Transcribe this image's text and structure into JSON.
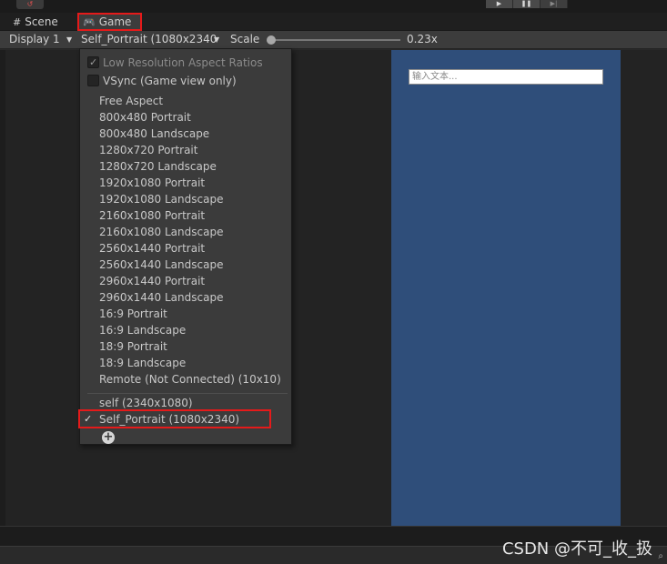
{
  "toolbar_top": {
    "play_icon": "▶",
    "pause_icon": "❚❚",
    "step_icon": "▶|"
  },
  "tabs": {
    "scene_icon": "#",
    "scene_label": "Scene",
    "game_icon": "🎮",
    "game_label": "Game"
  },
  "game_toolbar": {
    "display": "Display 1",
    "aspect": "Self_Portrait (1080x2340",
    "scale_label": "Scale",
    "scale_value": "0.23x",
    "dropdown_arrow": "▼"
  },
  "game_view": {
    "input_placeholder": "输入文本..."
  },
  "aspect_menu": {
    "low_res": "Low Resolution Aspect Ratios",
    "low_res_checked": true,
    "vsync": "VSync (Game view only)",
    "vsync_checked": false,
    "builtin": [
      "Free Aspect",
      "800x480 Portrait",
      "800x480 Landscape",
      "1280x720 Portrait",
      "1280x720 Landscape",
      "1920x1080 Portrait",
      "1920x1080 Landscape",
      "2160x1080 Portrait",
      "2160x1080 Landscape",
      "2560x1440 Portrait",
      "2560x1440 Landscape",
      "2960x1440 Portrait",
      "2960x1440 Landscape",
      "16:9 Portrait",
      "16:9 Landscape",
      "18:9 Portrait",
      "18:9 Landscape",
      "Remote (Not Connected) (10x10)"
    ],
    "custom": [
      "self (2340x1080)",
      "Self_Portrait (1080x2340)"
    ],
    "selected_mark": "✓",
    "add_icon": "+"
  },
  "watermark": "CSDN @不可_收_扱",
  "highlight_color": "#e51a1a",
  "game_background_color": "#2f4e7a"
}
